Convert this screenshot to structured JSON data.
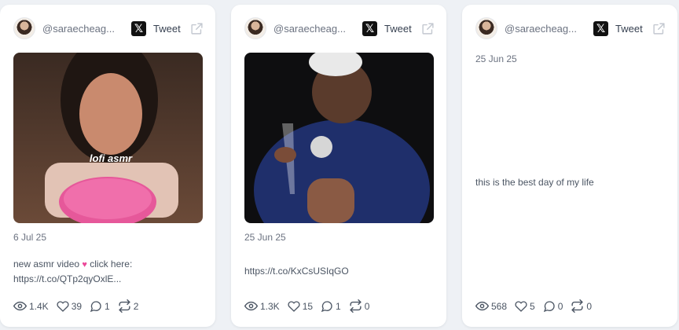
{
  "cards": [
    {
      "handle": "@saraecheag...",
      "tweet_label": "Tweet",
      "x_logo": "𝕏",
      "has_media": true,
      "media_caption": "lofi asmr",
      "date": "6 Jul 25",
      "text_line1": "new asmr video",
      "text_emoji": "♥",
      "text_line1_suffix": "click here:",
      "text_line2": "https://t.co/QTp2qyOxlE...",
      "stats": {
        "views": "1.4K",
        "likes": "39",
        "replies": "1",
        "retweets": "2"
      }
    },
    {
      "handle": "@saraecheag...",
      "tweet_label": "Tweet",
      "x_logo": "𝕏",
      "has_media": true,
      "date": "25 Jun 25",
      "text_line1": "https://t.co/KxCsUSIqGO",
      "stats": {
        "views": "1.3K",
        "likes": "15",
        "replies": "1",
        "retweets": "0"
      }
    },
    {
      "handle": "@saraecheag...",
      "tweet_label": "Tweet",
      "x_logo": "𝕏",
      "has_media": false,
      "date": "25 Jun 25",
      "text_line1": "this is the best day of my life",
      "stats": {
        "views": "568",
        "likes": "5",
        "replies": "0",
        "retweets": "0"
      }
    }
  ],
  "icons": {
    "view": "eye-icon",
    "like": "heart-icon",
    "reply": "comment-icon",
    "retweet": "retweet-icon",
    "external": "external-link-icon"
  },
  "colors": {
    "background": "#eef1f5",
    "card": "#ffffff",
    "text": "#4b5563",
    "muted": "#6b7280",
    "emoji_heart": "#ec4899"
  }
}
